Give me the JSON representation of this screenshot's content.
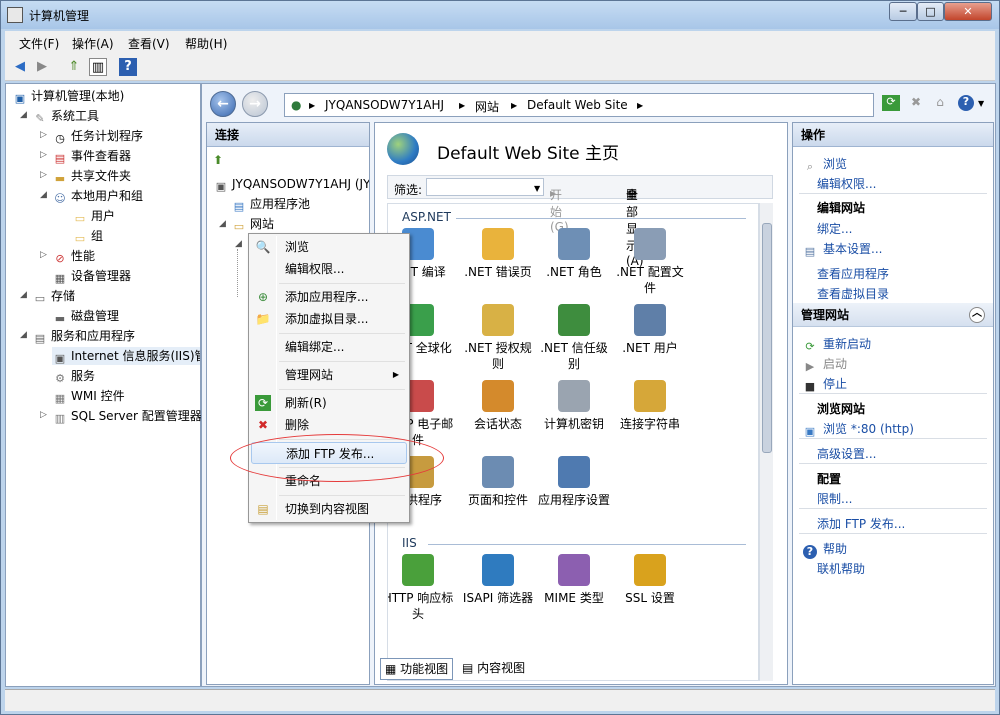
{
  "window": {
    "title": "计算机管理",
    "min": "─",
    "max": "□",
    "close": "✕"
  },
  "menu": [
    "文件(F)",
    "操作(A)",
    "查看(V)",
    "帮助(H)"
  ],
  "tree": [
    {
      "label": "计算机管理(本地)",
      "icon": "computer-icon",
      "level": 0
    },
    {
      "label": "系统工具",
      "icon": "tools-icon",
      "level": 1
    },
    {
      "label": "任务计划程序",
      "icon": "clock-icon",
      "level": 2
    },
    {
      "label": "事件查看器",
      "icon": "event-viewer-icon",
      "level": 2
    },
    {
      "label": "共享文件夹",
      "icon": "shared-folder-icon",
      "level": 2
    },
    {
      "label": "本地用户和组",
      "icon": "users-icon",
      "level": 2
    },
    {
      "label": "用户",
      "icon": "folder-icon",
      "level": 3
    },
    {
      "label": "组",
      "icon": "folder-icon",
      "level": 3
    },
    {
      "label": "性能",
      "icon": "performance-icon",
      "level": 2
    },
    {
      "label": "设备管理器",
      "icon": "device-manager-icon",
      "level": 2
    },
    {
      "label": "存储",
      "icon": "storage-icon",
      "level": 1
    },
    {
      "label": "磁盘管理",
      "icon": "disk-icon",
      "level": 2
    },
    {
      "label": "服务和应用程序",
      "icon": "services-apps-icon",
      "level": 1
    },
    {
      "label": "Internet 信息服务(IIS)管",
      "icon": "iis-icon",
      "level": 2
    },
    {
      "label": "服务",
      "icon": "services-icon",
      "level": 2
    },
    {
      "label": "WMI 控件",
      "icon": "wmi-icon",
      "level": 2
    },
    {
      "label": "SQL Server 配置管理器",
      "icon": "sql-icon",
      "level": 2
    }
  ],
  "address": {
    "parts": [
      "JYQANSODW7Y1AHJ",
      "网站",
      "Default Web Site"
    ],
    "sep": "▶"
  },
  "connections": {
    "title": "连接",
    "items": [
      {
        "label": "JYQANSODW7Y1AHJ (JY"
      },
      {
        "label": "应用程序池"
      },
      {
        "label": "网站"
      }
    ]
  },
  "center": {
    "title": "Default Web Site 主页",
    "filter_label": "筛选:",
    "start_label": "开始(G)",
    "show_all_label": "全部显示(A)",
    "groups": [
      {
        "name": "ASP.NET",
        "features": [
          [
            ".NET 编译",
            "#4a8bd1"
          ],
          [
            ".NET 错误页",
            "#e9b33c"
          ],
          [
            ".NET 角色",
            "#6e8fb5"
          ],
          [
            ".NET 配置文件",
            "#8a9db5"
          ],
          [
            ".NET 全球化",
            "#3a9f4b"
          ],
          [
            ".NET 授权规则",
            "#d8b145"
          ],
          [
            ".NET 信任级别",
            "#3e8d3e"
          ],
          [
            ".NET 用户",
            "#5f7fa8"
          ],
          [
            "HTTP 电子邮件",
            "#c94b4b"
          ],
          [
            "会话状态",
            "#d48a2c"
          ],
          [
            "计算机密钥",
            "#9aa4b0"
          ],
          [
            "连接字符串",
            "#d6a739"
          ],
          [
            "提供程序",
            "#c79b3f"
          ],
          [
            "页面和控件",
            "#6c8cb2"
          ],
          [
            "应用程序设置",
            "#4f7ab0"
          ]
        ]
      },
      {
        "name": "IIS",
        "features": [
          [
            "HTTP 响应标头",
            "#4aa03b"
          ],
          [
            "ISAPI 筛选器",
            "#2f7bbf"
          ],
          [
            "MIME 类型",
            "#8c5fb0"
          ],
          [
            "SSL 设置",
            "#d9a21d"
          ]
        ]
      }
    ],
    "tabs": [
      {
        "label": "功能视图"
      },
      {
        "label": "内容视图"
      }
    ]
  },
  "context_menu": [
    {
      "label": "浏览",
      "icon": "browse-icon",
      "glyph": "🔍"
    },
    {
      "label": "编辑权限...",
      "icon": "",
      "glyph": ""
    },
    {
      "label": "添加应用程序...",
      "icon": "add-app-icon",
      "glyph": "⊕"
    },
    {
      "label": "添加虚拟目录...",
      "icon": "add-vdir-icon",
      "glyph": "📁"
    },
    {
      "label": "编辑绑定...",
      "icon": "",
      "glyph": ""
    },
    {
      "label": "管理网站",
      "icon": "",
      "glyph": ""
    },
    {
      "label": "刷新(R)",
      "icon": "refresh-icon",
      "glyph": "⟳"
    },
    {
      "label": "删除",
      "icon": "delete-icon",
      "glyph": "✖"
    },
    {
      "label": "添加 FTP 发布...",
      "icon": "",
      "glyph": ""
    },
    {
      "label": "重命名",
      "icon": "",
      "glyph": ""
    },
    {
      "label": "切换到内容视图",
      "icon": "content-view-icon",
      "glyph": "▤"
    }
  ],
  "actions": {
    "title": "操作",
    "browse": "浏览",
    "edit_permissions": "编辑权限...",
    "edit_site_heading": "编辑网站",
    "bindings": "绑定...",
    "basic_settings": "基本设置...",
    "view_apps": "查看应用程序",
    "view_vdirs": "查看虚拟目录",
    "manage_site_heading": "管理网站",
    "restart": "重新启动",
    "start": "启动",
    "stop": "停止",
    "browse_site_heading": "浏览网站",
    "browse_port": "浏览 *:80 (http)",
    "advanced_settings": "高级设置...",
    "config_heading": "配置",
    "limits": "限制...",
    "add_ftp": "添加 FTP 发布...",
    "help": "帮助",
    "online_help": "联机帮助"
  }
}
